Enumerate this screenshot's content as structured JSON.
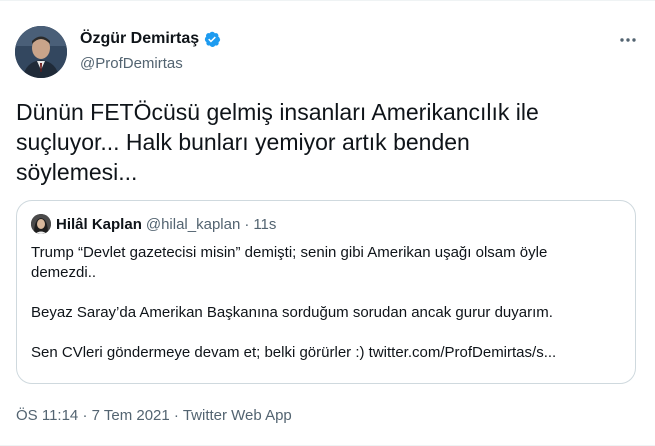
{
  "author": {
    "display_name": "Özgür Demirtaş",
    "handle": "@ProfDemirtas",
    "verified": true,
    "avatar_icon": "profile-photo"
  },
  "more_icon": "more-dots-icon",
  "tweet": {
    "lines": [
      "Dünün FETÖcüsü gelmiş insanları Amerikancılık ile",
      "suçluyor... Halk bunları yemiyor artık benden",
      "söylemesi..."
    ]
  },
  "quoted_tweet": {
    "display_name": "Hilâl Kaplan",
    "handle": "@hilal_kaplan",
    "separator": "·",
    "time": "11s",
    "paragraphs": [
      {
        "lines": [
          "Trump “Devlet gazetecisi misin” demişti; senin gibi Amerikan uşağı olsam öyle",
          "demezdi.."
        ]
      },
      {
        "lines": [
          "Beyaz Saray’da Amerikan Başkanına sorduğum sorudan ancak gurur duyarım."
        ]
      },
      {
        "lines": [
          "Sen CVleri göndermeye devam et; belki görürler :) twitter.com/ProfDemirtas/s..."
        ]
      }
    ]
  },
  "meta": {
    "time": "ÖS 11:14",
    "date": "7 Tem 2021",
    "source": "Twitter Web App",
    "separator": "·"
  },
  "colors": {
    "text_primary": "#0f1419",
    "text_secondary": "#536471",
    "verified_blue": "#1d9bf0",
    "border": "#cfd9de"
  }
}
